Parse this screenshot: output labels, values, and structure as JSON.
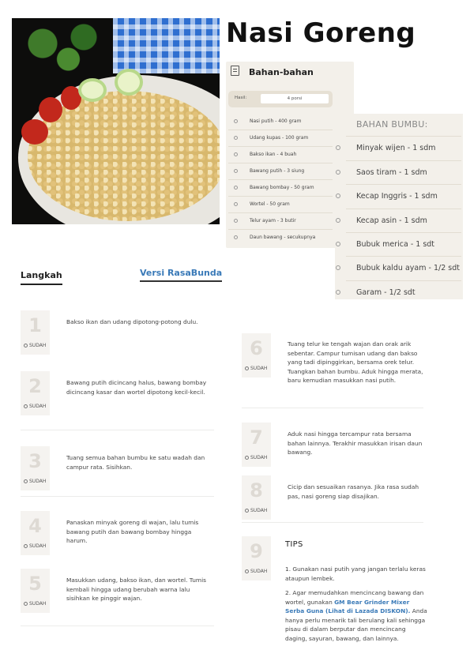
{
  "recipe": {
    "title": "Nasi Goreng"
  },
  "photo": {
    "subject": "nasi goreng plate"
  },
  "bahan": {
    "heading": "Bahan-bahan",
    "hasil_label": "Hasil:",
    "hasil_value": "4 porsi",
    "items": [
      "Nasi putih - 400 gram",
      "Udang kupas - 100 gram",
      "Bakso ikan - 4 buah",
      "Bawang putih - 3 siung",
      "Bawang bombay - 50 gram",
      "Wortel - 50 gram",
      "Telur ayam - 3 butir",
      "Daun bawang - secukupnya"
    ]
  },
  "bumbu": {
    "heading": "BAHAN BUMBU:",
    "items": [
      "Minyak wijen - 1 sdm",
      "Saos tiram - 1 sdm",
      "Kecap Inggris - 1 sdm",
      "Kecap asin - 1 sdm",
      "Bubuk merica - 1 sdt",
      "Bubuk kaldu ayam - 1/2 sdt",
      "Garam - 1/2 sdt"
    ]
  },
  "steps_header": {
    "tab_langkah": "Langkah",
    "tab_versi": "Versi RasaBunda"
  },
  "steps": [
    {
      "num": "1",
      "status": "SUDAH",
      "text": "Bakso ikan dan udang dipotong-potong dulu."
    },
    {
      "num": "2",
      "status": "SUDAH",
      "text": "Bawang putih dicincang halus, bawang bombay dicincang kasar dan wortel dipotong kecil-kecil."
    },
    {
      "num": "3",
      "status": "SUDAH",
      "text": "Tuang semua bahan bumbu ke satu wadah dan campur rata. Sisihkan."
    },
    {
      "num": "4",
      "status": "SUDAH",
      "text": "Panaskan minyak goreng di wajan, lalu tumis bawang putih dan bawang bombay hingga harum."
    },
    {
      "num": "5",
      "status": "SUDAH",
      "text": "Masukkan udang, bakso ikan, dan wortel. Tumis kembali hingga udang berubah warna lalu sisihkan ke pinggir wajan."
    },
    {
      "num": "6",
      "status": "SUDAH",
      "text": "Tuang telur ke tengah wajan dan orak arik sebentar. Campur tumisan udang dan bakso yang tadi dipinggirkan, bersama orek telur. Tuangkan bahan bumbu. Aduk hingga merata, baru kemudian masukkan nasi putih."
    },
    {
      "num": "7",
      "status": "SUDAH",
      "text": "Aduk nasi hingga tercampur rata bersama bahan lainnya. Terakhir masukkan irisan daun bawang."
    },
    {
      "num": "8",
      "status": "SUDAH",
      "text": "Cicip dan sesuaikan rasanya. Jika rasa sudah pas, nasi goreng siap disajikan."
    },
    {
      "num": "9",
      "status": "SUDAH",
      "text": ""
    }
  ],
  "tips": {
    "heading": "TIPS",
    "tip1": "1. Gunakan nasi putih yang jangan terlalu keras ataupun lembek.",
    "tip2_before": "2. Agar memudahkan mencincang bawang dan wortel, gunakan ",
    "tip2_link": "GM Bear Grinder Mixer Serba Guna (Lihat di Lazada DISKON).",
    "tip2_after": " Anda hanya perlu menarik tali berulang kali sehingga pisau di dalam berputar dan mencincang daging, sayuran, bawang, dan lainnya."
  }
}
